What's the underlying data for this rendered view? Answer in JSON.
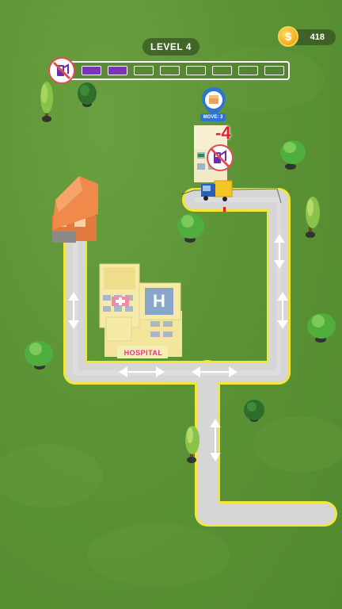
{
  "hud": {
    "level_text": "LEVEL 4",
    "coins": "418",
    "coin_symbol": "$"
  },
  "fuel": {
    "segments_total": 8,
    "segments_filled": 2,
    "fill_color": "#7b34b8",
    "icon": "fuel-pump-icon"
  },
  "objective": {
    "moves_text": "MOVE: 3",
    "icon": "package-icon"
  },
  "floating_text": {
    "penalty": "-4"
  },
  "hospital": {
    "sign": "HOSPITAL",
    "heli_letter": "H"
  },
  "colors": {
    "grass": "#5b9235",
    "road": "#d8d8d8",
    "road_edge": "#f3e53a",
    "roof_house": "#f08a4b",
    "hospital_wall": "#f4e59c"
  }
}
